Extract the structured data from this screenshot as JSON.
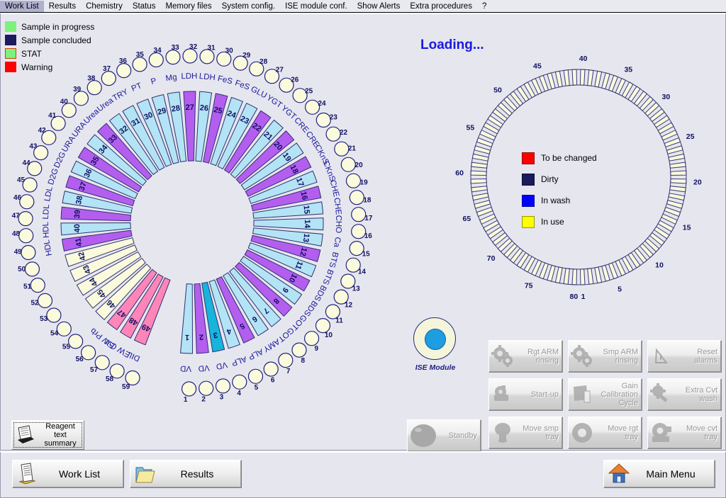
{
  "menu": {
    "items": [
      {
        "label": "Work List"
      },
      {
        "label": "Results"
      },
      {
        "label": "Chemistry"
      },
      {
        "label": "Status"
      },
      {
        "label": "Memory files"
      },
      {
        "label": "System config."
      },
      {
        "label": "ISE module conf."
      },
      {
        "label": "Show Alerts"
      },
      {
        "label": "Extra procedures"
      },
      {
        "label": "?"
      }
    ]
  },
  "sample_legend": {
    "items": [
      {
        "label": "Sample in progress",
        "color": "#7cf27c",
        "border": "#7cf27c"
      },
      {
        "label": "Sample concluded",
        "color": "#1a1a5e",
        "border": "#1a1a5e"
      },
      {
        "label": "STAT",
        "color": "#7cf27c",
        "border": "#d04000"
      },
      {
        "label": "Warning",
        "color": "#ff0000",
        "border": "#ff0000"
      }
    ]
  },
  "status": {
    "loading_text": "Loading..."
  },
  "reagent_wheel": {
    "name": "reagent-tray",
    "segment_count": 49,
    "colors": {
      "blue": "#b3e4f5",
      "purple": "#b45ef0",
      "cyan": "#18b4dc",
      "cream": "#fafadc",
      "pink": "#ff85b8"
    },
    "segments": [
      {
        "n": 1,
        "color": "blue",
        "label": "VD"
      },
      {
        "n": 2,
        "color": "purple",
        "label": "VD"
      },
      {
        "n": 3,
        "color": "cyan",
        "label": "VD"
      },
      {
        "n": 4,
        "color": "blue",
        "label": "ALP"
      },
      {
        "n": 5,
        "color": "purple",
        "label": "ALP"
      },
      {
        "n": 6,
        "color": "blue",
        "label": "AMY"
      },
      {
        "n": 7,
        "color": "blue",
        "label": "GOT"
      },
      {
        "n": 8,
        "color": "purple",
        "label": "GOT"
      },
      {
        "n": 9,
        "color": "blue",
        "label": "BDS"
      },
      {
        "n": 10,
        "color": "purple",
        "label": "BDS"
      },
      {
        "n": 11,
        "color": "blue",
        "label": "BTS"
      },
      {
        "n": 12,
        "color": "purple",
        "label": "BTS"
      },
      {
        "n": 13,
        "color": "blue",
        "label": "Ca"
      },
      {
        "n": 14,
        "color": "blue",
        "label": "CHO"
      },
      {
        "n": 15,
        "color": "blue",
        "label": "CHE"
      },
      {
        "n": 16,
        "color": "purple",
        "label": "CHE"
      },
      {
        "n": 17,
        "color": "blue",
        "label": "CKnS"
      },
      {
        "n": 18,
        "color": "purple",
        "label": "CKnS"
      },
      {
        "n": 19,
        "color": "blue",
        "label": "CRE"
      },
      {
        "n": 20,
        "color": "purple",
        "label": "CRE"
      },
      {
        "n": 21,
        "color": "blue",
        "label": "YGT"
      },
      {
        "n": 22,
        "color": "purple",
        "label": "YGT"
      },
      {
        "n": 23,
        "color": "blue",
        "label": "GLU"
      },
      {
        "n": 24,
        "color": "blue",
        "label": "FeS"
      },
      {
        "n": 25,
        "color": "purple",
        "label": "FeS"
      },
      {
        "n": 26,
        "color": "blue",
        "label": "LDH"
      },
      {
        "n": 27,
        "color": "purple",
        "label": "LDH"
      },
      {
        "n": 28,
        "color": "blue",
        "label": "Mg"
      },
      {
        "n": 29,
        "color": "blue",
        "label": "P"
      },
      {
        "n": 30,
        "color": "blue",
        "label": "PT"
      },
      {
        "n": 31,
        "color": "blue",
        "label": "TRY"
      },
      {
        "n": 32,
        "color": "blue",
        "label": "Urea"
      },
      {
        "n": 33,
        "color": "purple",
        "label": "Urea"
      },
      {
        "n": 34,
        "color": "blue",
        "label": "URA"
      },
      {
        "n": 35,
        "color": "purple",
        "label": "URA"
      },
      {
        "n": 36,
        "color": "blue",
        "label": "D2G"
      },
      {
        "n": 37,
        "color": "purple",
        "label": "D2G"
      },
      {
        "n": 38,
        "color": "blue",
        "label": "LDL"
      },
      {
        "n": 39,
        "color": "purple",
        "label": "LDL"
      },
      {
        "n": 40,
        "color": "blue",
        "label": "HDL"
      },
      {
        "n": 41,
        "color": "purple",
        "label": "HDL"
      },
      {
        "n": 42,
        "color": "cream",
        "label": ""
      },
      {
        "n": 43,
        "color": "cream",
        "label": ""
      },
      {
        "n": 44,
        "color": "cream",
        "label": ""
      },
      {
        "n": 45,
        "color": "cream",
        "label": ""
      },
      {
        "n": 46,
        "color": "cream",
        "label": ""
      },
      {
        "n": 47,
        "color": "pink",
        "label": "EW Prb"
      },
      {
        "n": 48,
        "color": "pink",
        "label": "EW Cvt"
      },
      {
        "n": 49,
        "color": "pink",
        "label": "DIL"
      }
    ],
    "sample_positions": {
      "count": 59,
      "first": 1,
      "last": 59,
      "fill": "#fafadc",
      "stroke": "#202080"
    }
  },
  "cuvette_ring": {
    "name": "cuvette-tray",
    "count": 80,
    "fill": "#fafadc",
    "stroke": "#3a3a7a",
    "tick_labels": [
      "1",
      "5",
      "10",
      "15",
      "20",
      "25",
      "30",
      "35",
      "40",
      "45",
      "50",
      "55",
      "60",
      "65",
      "70",
      "75",
      "80"
    ],
    "legend": [
      {
        "label": "To be changed",
        "color": "#ff0000",
        "border": "#990000"
      },
      {
        "label": "Dirty",
        "color": "#1a1a5e",
        "border": "#0d0d30"
      },
      {
        "label": "In wash",
        "color": "#0000ff",
        "border": "#000099"
      },
      {
        "label": "In use",
        "color": "#ffff00",
        "border": "#999900"
      }
    ]
  },
  "ise": {
    "label": "ISE Module",
    "outer_color": "#f5f5dc",
    "inner_color": "#1e9ee0"
  },
  "actions": [
    {
      "id": "rgt-arm-rinsing",
      "label": "Rgt ARM\nrinsing",
      "icon": "gear-icon",
      "enabled": false
    },
    {
      "id": "smp-arm-rinsing",
      "label": "Smp ARM\nrinsing",
      "icon": "gear-icon",
      "enabled": false
    },
    {
      "id": "reset-alarms",
      "label": "Reset\nalarms",
      "icon": "alarm-bell-icon",
      "enabled": false
    },
    {
      "id": "start-up",
      "label": "Start-up",
      "icon": "pump-icon",
      "enabled": false
    },
    {
      "id": "gain-calibration",
      "label": "Gain\nCalibration\nCycle",
      "icon": "calibration-icon",
      "enabled": false
    },
    {
      "id": "extra-cvt-wash",
      "label": "Extra Cvt\nwash",
      "icon": "brush-icon",
      "enabled": false
    },
    {
      "id": "move-smp-tray",
      "label": "Move smp\ntray",
      "icon": "sample-tray-icon",
      "enabled": false
    },
    {
      "id": "move-rgt-tray",
      "label": "Move rgt tray",
      "icon": "reagent-tray-icon",
      "enabled": false
    },
    {
      "id": "move-cvt-tray",
      "label": "Move cvt\ntray",
      "icon": "cuvette-tray-icon",
      "enabled": false
    }
  ],
  "standby": {
    "label": "Standby",
    "icon": "standby-icon",
    "enabled": false
  },
  "reagent_summary": {
    "label": "Reagent\ntext\nsummary",
    "icon": "document-printer-icon"
  },
  "bottom_bar": {
    "work_list": {
      "label": "Work List",
      "icon": "clipboard-icon"
    },
    "results": {
      "label": "Results",
      "icon": "folder-icon"
    },
    "main_menu": {
      "label": "Main Menu",
      "icon": "house-icon"
    }
  }
}
